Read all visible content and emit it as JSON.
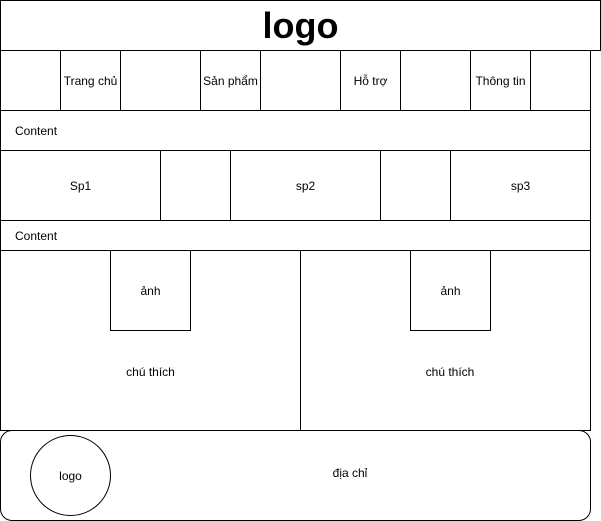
{
  "header": {
    "logo": "logo"
  },
  "nav": {
    "items": [
      "Trang chủ",
      "Sản phẩm",
      "Hỗ trợ",
      "Thông tin"
    ]
  },
  "content_label_1": "Content",
  "products": [
    "Sp1",
    "sp2",
    "sp3"
  ],
  "content_label_2": "Content",
  "cards": [
    {
      "image": "ảnh",
      "caption": "chú thích"
    },
    {
      "image": "ảnh",
      "caption": "chú thích"
    }
  ],
  "footer": {
    "logo": "logo",
    "address": "địa chỉ"
  }
}
